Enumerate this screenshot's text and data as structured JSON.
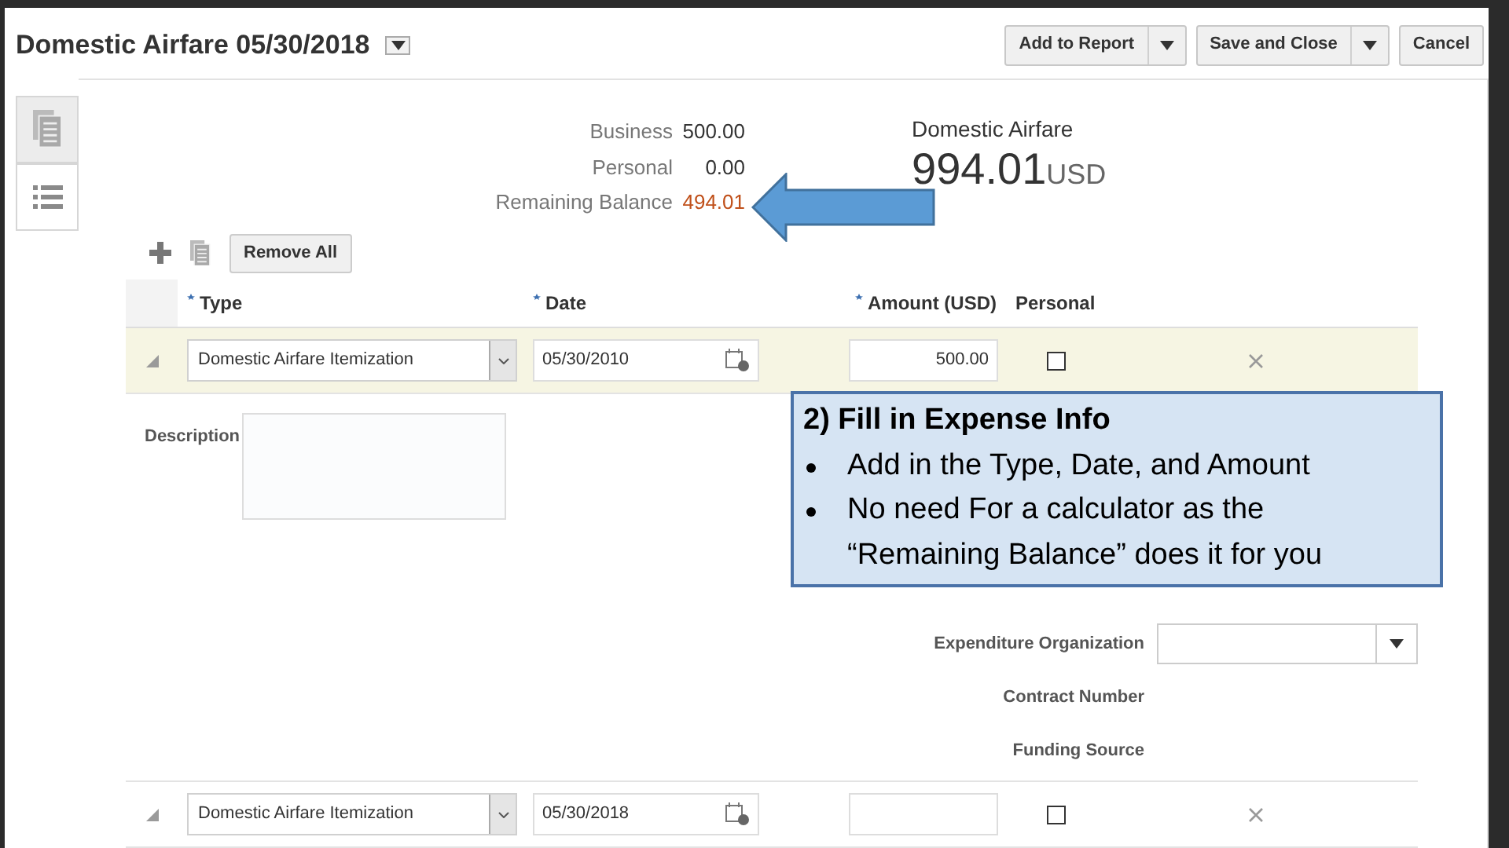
{
  "header": {
    "title": "Domestic Airfare 05/30/2018",
    "buttons": [
      {
        "label": "Add to Report",
        "menu": true
      },
      {
        "label": "Save and Close",
        "menu": true
      },
      {
        "label": "Cancel",
        "menu": false
      }
    ]
  },
  "side_tabs": [
    {
      "kind": "document",
      "selected": true
    },
    {
      "kind": "list",
      "selected": false
    }
  ],
  "summary": {
    "rows": [
      {
        "label": "Business",
        "value": "500.00",
        "highlight": false
      },
      {
        "label": "Personal",
        "value": "0.00",
        "highlight": false
      },
      {
        "label": "Remaining Balance",
        "value": "494.01",
        "highlight": true
      }
    ],
    "category": "Domestic Airfare",
    "amount": "994.01",
    "currency": "USD"
  },
  "toolbar": {
    "buttons": [
      "Remove All"
    ]
  },
  "table": {
    "columns": [
      {
        "label": "Type",
        "required": true
      },
      {
        "label": "Date",
        "required": true
      },
      {
        "label": "Amount (USD)",
        "required": true
      },
      {
        "label": "Personal",
        "required": false
      }
    ],
    "rows": [
      {
        "type": "Domestic Airfare Itemization",
        "date": "05/30/2010",
        "amount": "500.00",
        "personal": false,
        "selected": true,
        "details": {
          "description_label": "Description",
          "fields": [
            {
              "label": "Expenditure Organization",
              "kind": "select"
            },
            {
              "label": "Contract Number",
              "kind": "text"
            },
            {
              "label": "Funding Source",
              "kind": "text"
            }
          ]
        }
      },
      {
        "type": "Domestic Airfare Itemization",
        "date": "05/30/2018",
        "personal": false,
        "selected": false
      }
    ]
  },
  "callout": {
    "title": "2) Fill in Expense Info",
    "bullets": [
      "Add in the Type, Date, and Amount",
      "No need For a calculator as the “Remaining Balance” does it for you"
    ]
  }
}
